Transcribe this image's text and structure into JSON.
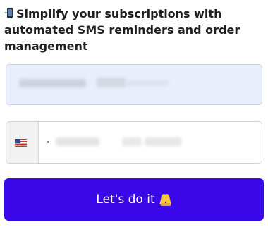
{
  "form": {
    "headline": "Simplify your subscriptions with automated SMS reminders and order management",
    "headline_icon": "mobile-phone-with-arrow-emoji",
    "email_field": {
      "value": "",
      "background": "#e9eefc"
    },
    "phone_field": {
      "country_flag_icon": "us-flag-icon",
      "value": ""
    },
    "submit_button": {
      "label": "Let's do it",
      "icon": "folded-hands-emoji",
      "color": "#3a07e8"
    }
  }
}
